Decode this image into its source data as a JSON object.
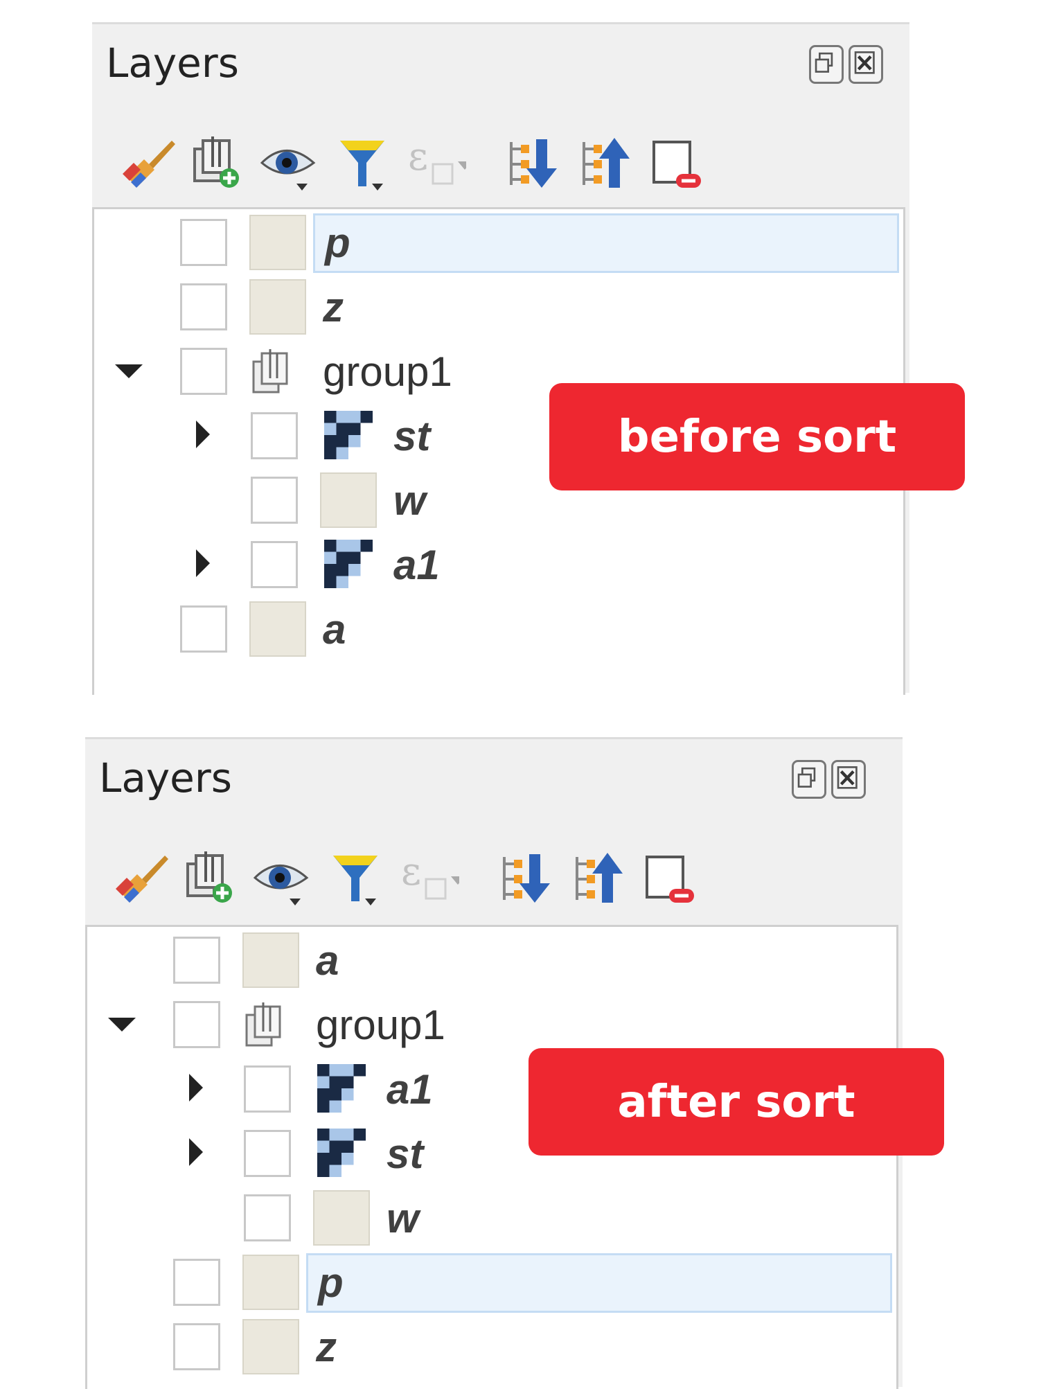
{
  "panels": [
    {
      "title": "Layers",
      "badge": "before sort",
      "rows": [
        {
          "label": "p",
          "indent": 0,
          "kind": "vector",
          "italic": true,
          "selected": true,
          "arrow": "none"
        },
        {
          "label": "z",
          "indent": 0,
          "kind": "vector",
          "italic": true,
          "selected": false,
          "arrow": "none"
        },
        {
          "label": "group1",
          "indent": 0,
          "kind": "group",
          "italic": false,
          "selected": false,
          "arrow": "down"
        },
        {
          "label": "st",
          "indent": 1,
          "kind": "raster",
          "italic": true,
          "selected": false,
          "arrow": "right"
        },
        {
          "label": "w",
          "indent": 1,
          "kind": "vector",
          "italic": true,
          "selected": false,
          "arrow": "none"
        },
        {
          "label": "a1",
          "indent": 1,
          "kind": "raster",
          "italic": true,
          "selected": false,
          "arrow": "right"
        },
        {
          "label": "a",
          "indent": 0,
          "kind": "vector",
          "italic": true,
          "selected": false,
          "arrow": "none"
        }
      ]
    },
    {
      "title": "Layers",
      "badge": "after sort",
      "rows": [
        {
          "label": "a",
          "indent": 0,
          "kind": "vector",
          "italic": true,
          "selected": false,
          "arrow": "none"
        },
        {
          "label": "group1",
          "indent": 0,
          "kind": "group",
          "italic": false,
          "selected": false,
          "arrow": "down"
        },
        {
          "label": "a1",
          "indent": 1,
          "kind": "raster",
          "italic": true,
          "selected": false,
          "arrow": "right"
        },
        {
          "label": "st",
          "indent": 1,
          "kind": "raster",
          "italic": true,
          "selected": false,
          "arrow": "right"
        },
        {
          "label": "w",
          "indent": 1,
          "kind": "vector",
          "italic": true,
          "selected": false,
          "arrow": "none"
        },
        {
          "label": "p",
          "indent": 0,
          "kind": "vector",
          "italic": true,
          "selected": true,
          "arrow": "none"
        },
        {
          "label": "z",
          "indent": 0,
          "kind": "vector",
          "italic": true,
          "selected": false,
          "arrow": "none"
        }
      ]
    }
  ],
  "toolbar_icons": [
    "style-manager-icon",
    "add-group-icon",
    "manage-visibility-icon",
    "filter-legend-icon",
    "filter-by-expression-icon",
    "expand-all-icon",
    "collapse-all-icon",
    "remove-layer-icon"
  ],
  "colors": {
    "badge": "#ee2730",
    "swatch": "#ebe8dd",
    "selection": "#eaf3fc",
    "raster_dark": "#1a2a44",
    "raster_light": "#a9c6e8"
  }
}
